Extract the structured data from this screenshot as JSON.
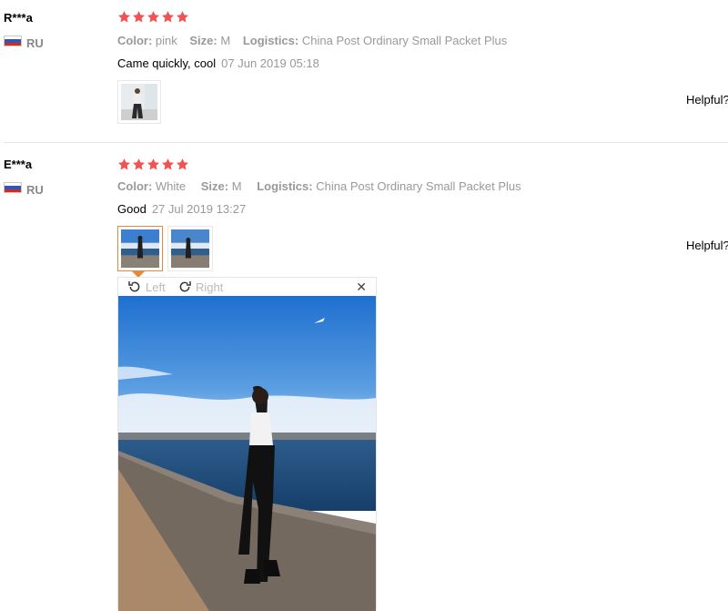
{
  "reviews": [
    {
      "user": "R***a",
      "country": "RU",
      "rating_stars": 5,
      "attrs": {
        "color_label": "Color:",
        "color": "pink",
        "size_label": "Size:",
        "size": "M",
        "logistics_label": "Logistics:",
        "logistics": "China Post Ordinary Small Packet Plus"
      },
      "feedback": "Came quickly, cool",
      "date": "07 Jun 2019 05:18",
      "helpful": "Helpful?"
    },
    {
      "user": "E***a",
      "country": "RU",
      "rating_stars": 5,
      "attrs": {
        "color_label": "Color:",
        "color": "White",
        "size_label": "Size:",
        "size": "M",
        "logistics_label": "Logistics:",
        "logistics": "China Post Ordinary Small Packet Plus"
      },
      "feedback": "Good",
      "date": "27 Jul 2019 13:27",
      "helpful": "Helpful?"
    }
  ],
  "viewer": {
    "rotate_left": "Left",
    "rotate_right": "Right",
    "close": "✕"
  },
  "colors": {
    "star": "#f05353",
    "active_thumb": "#e58a3c",
    "muted_text": "#999999"
  },
  "icons": [
    "star-icon",
    "russia-flag-icon",
    "rotate-left-icon",
    "rotate-right-icon",
    "close-icon"
  ]
}
